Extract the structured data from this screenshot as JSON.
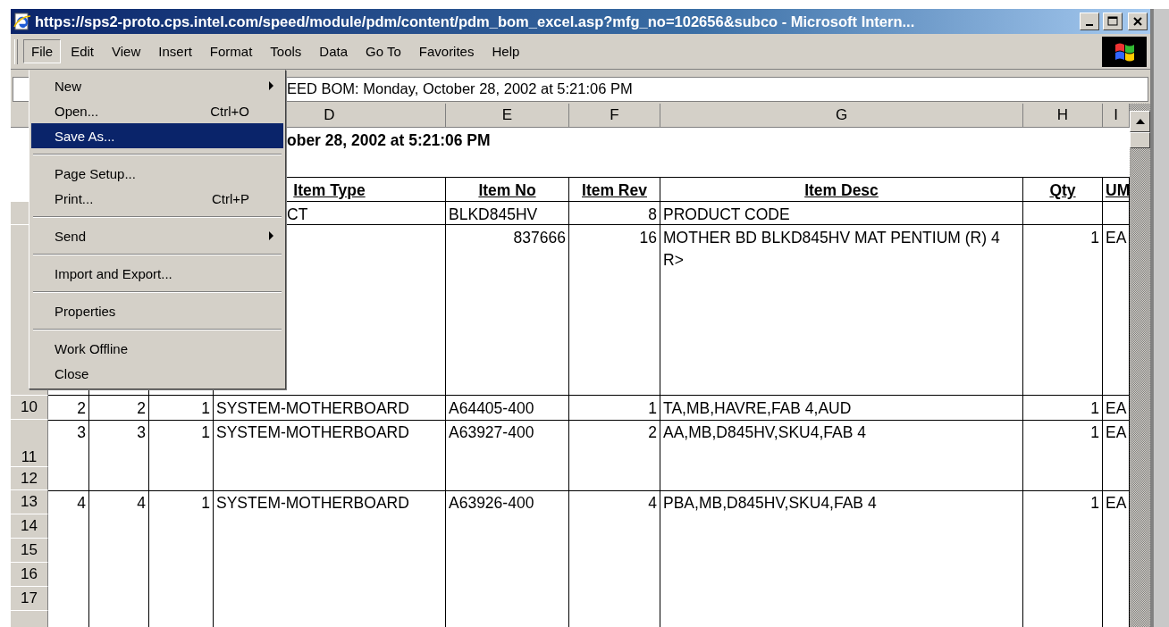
{
  "window": {
    "title": "https://sps2-proto.cps.intel.com/speed/module/pdm/content/pdm_bom_excel.asp?mfg_no=102656&subco - Microsoft Intern..."
  },
  "menu_bar": [
    {
      "label": "File",
      "selected": true
    },
    {
      "label": "Edit",
      "selected": false
    },
    {
      "label": "View",
      "selected": false
    },
    {
      "label": "Insert",
      "selected": false
    },
    {
      "label": "Format",
      "selected": false
    },
    {
      "label": "Tools",
      "selected": false
    },
    {
      "label": "Data",
      "selected": false
    },
    {
      "label": "Go To",
      "selected": false
    },
    {
      "label": "Favorites",
      "selected": false
    },
    {
      "label": "Help",
      "selected": false
    }
  ],
  "file_menu": [
    {
      "kind": "item",
      "label": "New",
      "submenu": true,
      "selected": false
    },
    {
      "kind": "item",
      "label": "Open...",
      "shortcut": "Ctrl+O",
      "selected": false
    },
    {
      "kind": "item",
      "label": "Save As...",
      "selected": true
    },
    {
      "kind": "separator"
    },
    {
      "kind": "item",
      "label": "Page Setup...",
      "selected": false
    },
    {
      "kind": "item",
      "label": "Print...",
      "shortcut": "Ctrl+P",
      "selected": false
    },
    {
      "kind": "separator"
    },
    {
      "kind": "item",
      "label": "Send",
      "submenu": true,
      "selected": false
    },
    {
      "kind": "separator"
    },
    {
      "kind": "item",
      "label": "Import and Export...",
      "selected": false
    },
    {
      "kind": "separator"
    },
    {
      "kind": "item",
      "label": "Properties",
      "selected": false
    },
    {
      "kind": "separator"
    },
    {
      "kind": "item",
      "label": "Work Offline",
      "selected": false
    },
    {
      "kind": "item",
      "label": "Close",
      "selected": false
    }
  ],
  "formula_bar": {
    "value": "EED BOM: Monday, October 28, 2002 at 5:21:06 PM"
  },
  "sheet": {
    "columns": [
      "D",
      "E",
      "F",
      "G",
      "H",
      "I"
    ],
    "title": "ober 28, 2002 at 5:21:06 PM",
    "header": {
      "item_type": "Item Type",
      "item_no": "Item No",
      "item_rev": "Item Rev",
      "item_desc": "Item Desc",
      "qty": "Qty",
      "um": "UM"
    },
    "rows": [
      {
        "item_type": "CT",
        "item_no": "BLKD845HV",
        "item_rev": "8",
        "item_desc": "PRODUCT CODE"
      },
      {
        "item_no": "837666",
        "item_rev": "16",
        "item_desc": "MOTHER BD BLKD845HV MAT PENTIUM (R) 4 R>",
        "qty": "1",
        "um": "EA"
      },
      {
        "row_labels": [
          "10"
        ],
        "col_a": "2",
        "col_b": "2",
        "col_c": "1",
        "item_type": "SYSTEM-MOTHERBOARD",
        "item_no": "A64405-400",
        "item_rev": "1",
        "item_desc": "TA,MB,HAVRE,FAB 4,AUD",
        "qty": "1",
        "um": "EA"
      },
      {
        "row_labels": [
          "11",
          "12"
        ],
        "col_a": "3",
        "col_b": "3",
        "col_c": "1",
        "item_type": "SYSTEM-MOTHERBOARD",
        "item_no": "A63927-400",
        "item_rev": "2",
        "item_desc": "AA,MB,D845HV,SKU4,FAB 4",
        "qty": "1",
        "um": "EA"
      },
      {
        "row_labels": [
          "13",
          "14",
          "15",
          "16",
          "17"
        ],
        "col_a": "4",
        "col_b": "4",
        "col_c": "1",
        "item_type": "SYSTEM-MOTHERBOARD",
        "item_no": "A63926-400",
        "item_rev": "4",
        "item_desc": "PBA,MB,D845HV,SKU4,FAB 4",
        "qty": "1",
        "um": "EA"
      }
    ]
  }
}
